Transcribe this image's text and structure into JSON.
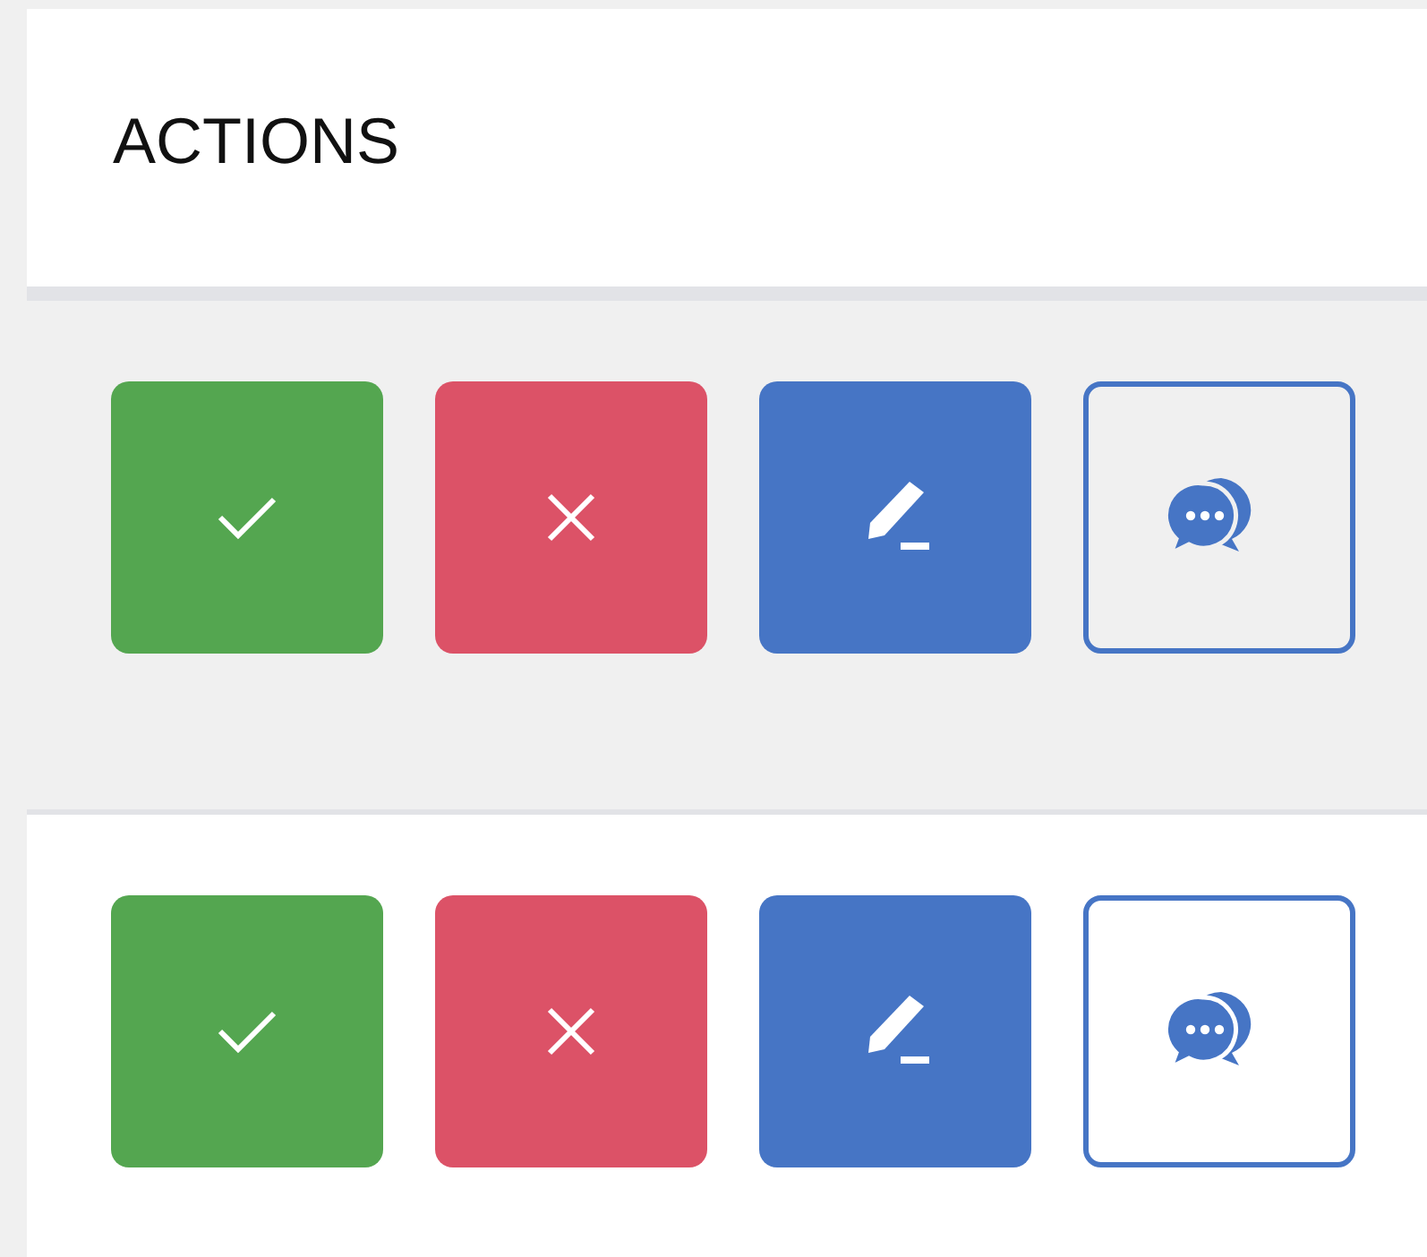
{
  "header": {
    "title": "ACTIONS"
  },
  "rows": [
    {
      "highlighted": true,
      "actions": [
        {
          "kind": "approve"
        },
        {
          "kind": "reject"
        },
        {
          "kind": "edit"
        },
        {
          "kind": "comment"
        }
      ]
    },
    {
      "highlighted": false,
      "actions": [
        {
          "kind": "approve"
        },
        {
          "kind": "reject"
        },
        {
          "kind": "edit"
        },
        {
          "kind": "comment"
        }
      ]
    }
  ]
}
